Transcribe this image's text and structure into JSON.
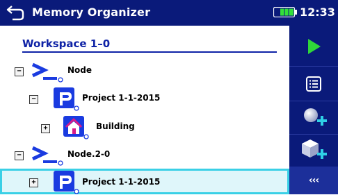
{
  "titlebar": {
    "title": "Memory Organizer",
    "time": "12:33"
  },
  "workspace": {
    "label": "Workspace 1–0"
  },
  "tree": [
    {
      "toggle": "−",
      "type": "node",
      "label": "Node"
    },
    {
      "toggle": "−",
      "type": "project",
      "label": "Project 1-1-2015"
    },
    {
      "toggle": "+",
      "type": "building",
      "label": "Building"
    },
    {
      "toggle": "−",
      "type": "node",
      "label": "Node.2-0"
    },
    {
      "toggle": "+",
      "type": "project",
      "label": "Project 1-1-2015",
      "selected": true
    }
  ],
  "sidebar": {
    "more_label": "‹‹‹"
  },
  "colors": {
    "header": "#0a1a7a",
    "accent": "#0e22a6",
    "play": "#2fd63a",
    "plus": "#2fd0e6",
    "selection": "#3ad0e6"
  },
  "icons": [
    "back-arrow-icon",
    "battery-icon",
    "play-icon",
    "list-icon",
    "add-measurement-icon",
    "add-structure-icon",
    "node-icon",
    "project-icon",
    "building-icon"
  ]
}
